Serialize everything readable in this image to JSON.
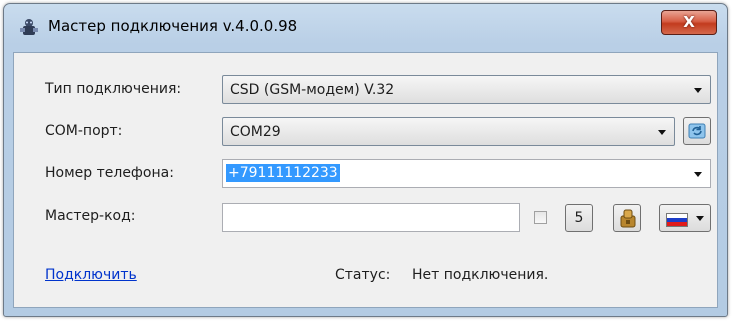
{
  "window": {
    "title": "Мастер подключения v.4.0.0.98",
    "close_label": "X"
  },
  "form": {
    "connection_type_label": "Тип подключения:",
    "connection_type_value": "CSD (GSM-модем) V.32",
    "com_port_label": "COM-порт:",
    "com_port_value": "COM29",
    "phone_label": "Номер телефона:",
    "phone_value": "+79111112233",
    "master_code_label": "Мастер-код:",
    "master_code_value": "",
    "number_button_label": "5",
    "language_flag": "russian-flag"
  },
  "footer": {
    "connect_link": "Подключить",
    "status_label": "Статус:",
    "status_value": "Нет подключения."
  },
  "colors": {
    "selection": "#3399ff",
    "link": "#0033cc",
    "close_button": "#c9452a"
  }
}
